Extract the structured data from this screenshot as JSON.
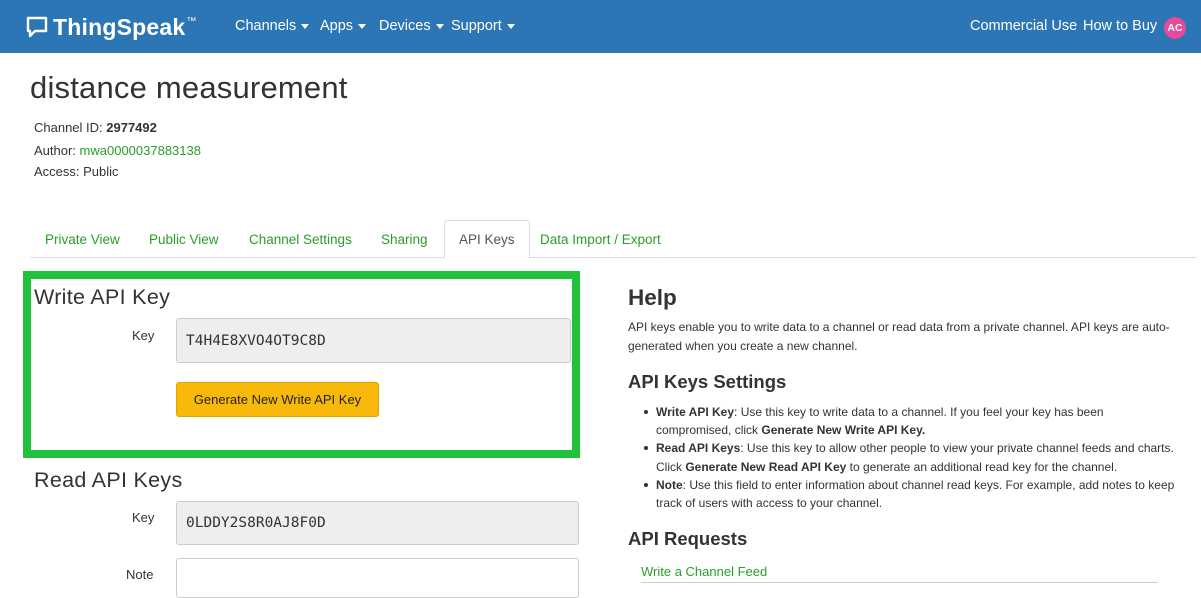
{
  "navbar": {
    "brand": "ThingSpeak",
    "brand_tm": "™",
    "menu": [
      {
        "label": "Channels"
      },
      {
        "label": "Apps"
      },
      {
        "label": "Devices"
      },
      {
        "label": "Support"
      }
    ],
    "right": [
      {
        "label": "Commercial Use"
      },
      {
        "label": "How to Buy"
      }
    ],
    "avatar_initials": "AC",
    "avatar_color": "#e8499a",
    "bar_color": "#2c76b5"
  },
  "channel": {
    "title": "distance measurement",
    "id_label": "Channel ID: ",
    "id_value": "2977492",
    "author_label": "Author: ",
    "author_value": "mwa0000037883138",
    "access_label": "Access: ",
    "access_value": "Public"
  },
  "tabs": [
    {
      "label": "Private View"
    },
    {
      "label": "Public View"
    },
    {
      "label": "Channel Settings"
    },
    {
      "label": "Sharing"
    },
    {
      "label": "API Keys",
      "active": true
    },
    {
      "label": "Data Import / Export"
    }
  ],
  "write_key": {
    "heading": "Write API Key",
    "key_label": "Key",
    "key_value": "T4H4E8XVO4OT9C8D",
    "button_label": "Generate New Write API Key",
    "highlight_color": "#1fc23a"
  },
  "read_keys": {
    "heading": "Read API Keys",
    "key_label": "Key",
    "key_value": "0LDDY2S8R0AJ8F0D",
    "note_label": "Note"
  },
  "help": {
    "title": "Help",
    "intro": "API keys enable you to write data to a channel or read data from a private channel. API keys are auto-generated when you create a new channel.",
    "settings_heading": "API Keys Settings",
    "items": [
      {
        "bold": "Write API Key",
        "text": ": Use this key to write data to a channel. If you feel your key has been compromised, click ",
        "bold2": "Generate New Write API Key.",
        "text2": ""
      },
      {
        "bold": "Read API Keys",
        "text": ": Use this key to allow other people to view your private channel feeds and charts. Click ",
        "bold2": "Generate New Read API Key",
        "text2": " to generate an additional read key for the channel."
      },
      {
        "bold": "Note",
        "text": ": Use this field to enter information about channel read keys. For example, add notes to keep track of users with access to your channel.",
        "bold2": "",
        "text2": ""
      }
    ],
    "requests_heading": "API Requests",
    "feed_link": "Write a Channel Feed"
  }
}
